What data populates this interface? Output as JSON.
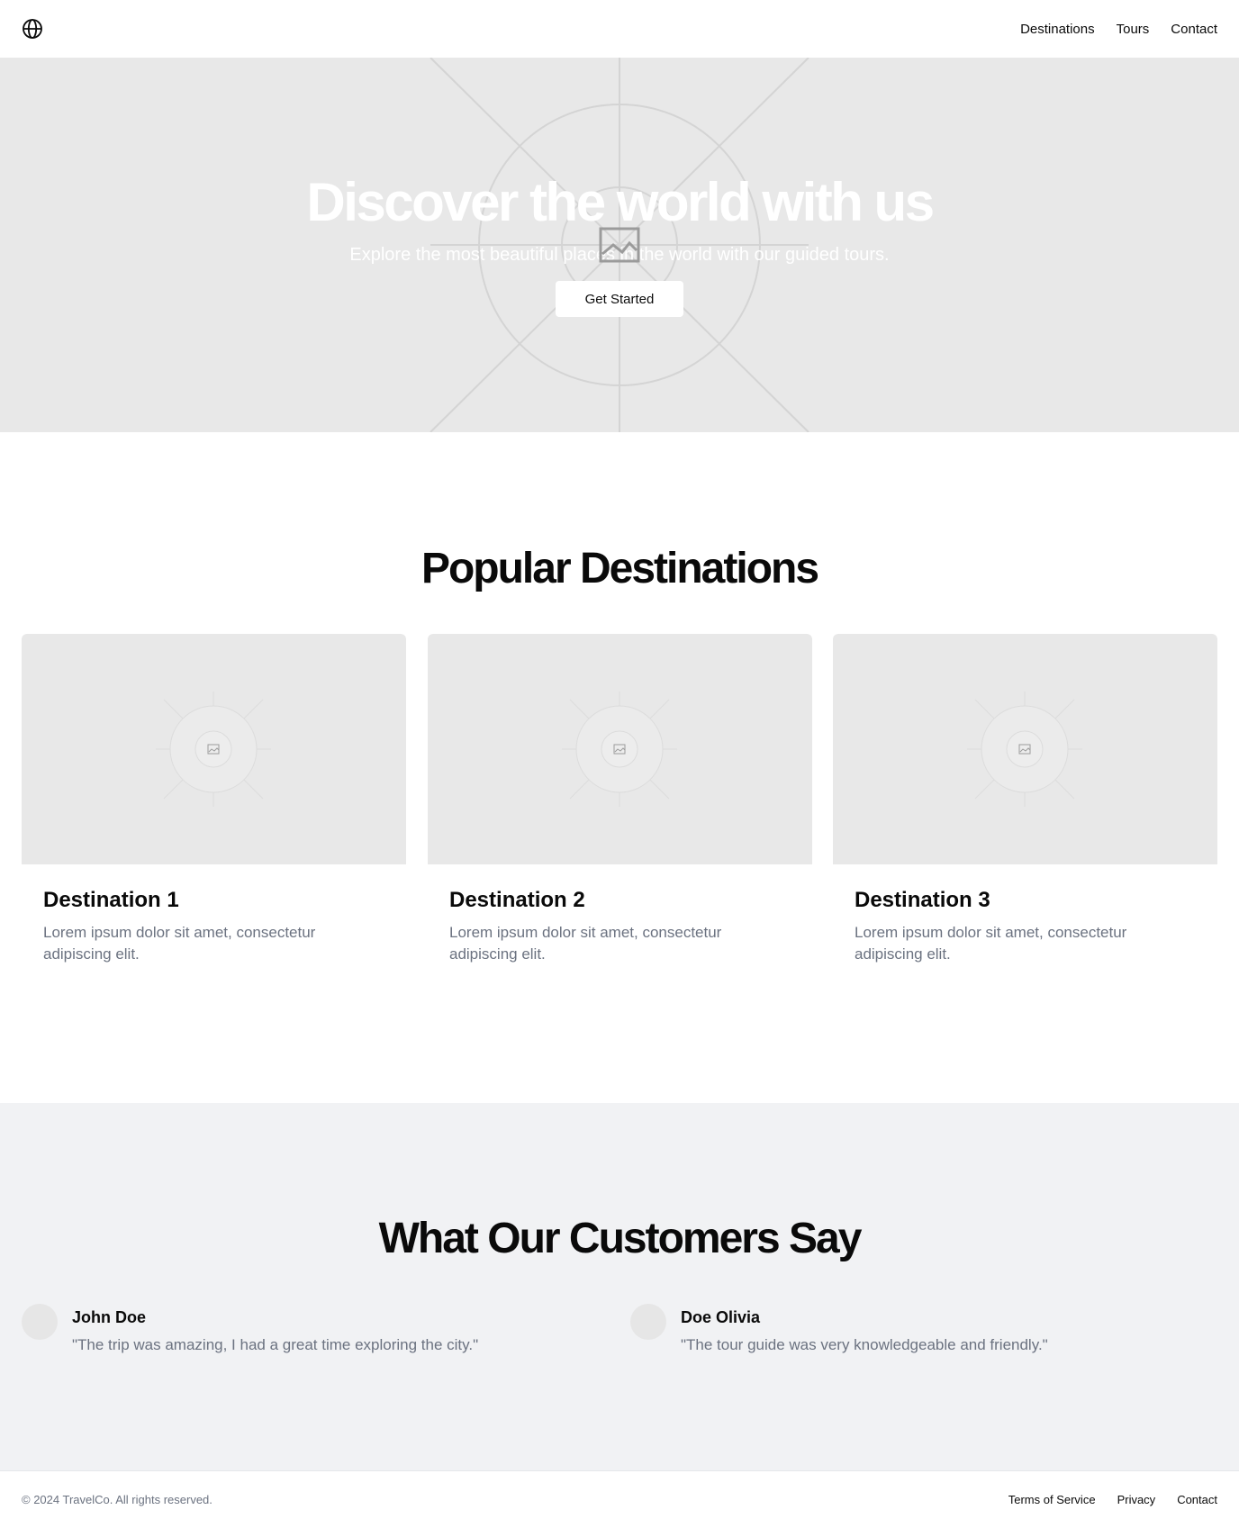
{
  "header": {
    "logo_icon": "globe-icon",
    "nav": [
      "Destinations",
      "Tours",
      "Contact"
    ]
  },
  "hero": {
    "title": "Discover the world with us",
    "subtitle": "Explore the most beautiful places in the world with our guided tours.",
    "cta": "Get Started",
    "image_icon": "image-placeholder-icon"
  },
  "destinations": {
    "title": "Popular Destinations",
    "cards": [
      {
        "title": "Destination 1",
        "description": "Lorem ipsum dolor sit amet, consectetur adipiscing elit."
      },
      {
        "title": "Destination 2",
        "description": "Lorem ipsum dolor sit amet, consectetur adipiscing elit."
      },
      {
        "title": "Destination 3",
        "description": "Lorem ipsum dolor sit amet, consectetur adipiscing elit."
      }
    ]
  },
  "testimonials": {
    "title": "What Our Customers Say",
    "items": [
      {
        "name": "John Doe",
        "quote": "\"The trip was amazing, I had a great time exploring the city.\""
      },
      {
        "name": "Doe Olivia",
        "quote": "\"The tour guide was very knowledgeable and friendly.\""
      }
    ]
  },
  "footer": {
    "copyright": "© 2024 TravelCo. All rights reserved.",
    "links": [
      "Terms of Service",
      "Privacy",
      "Contact"
    ]
  },
  "colors": {
    "placeholder_bg": "#e8e8e8",
    "muted_text": "#6b7280",
    "testimonial_bg": "#f1f2f4"
  }
}
